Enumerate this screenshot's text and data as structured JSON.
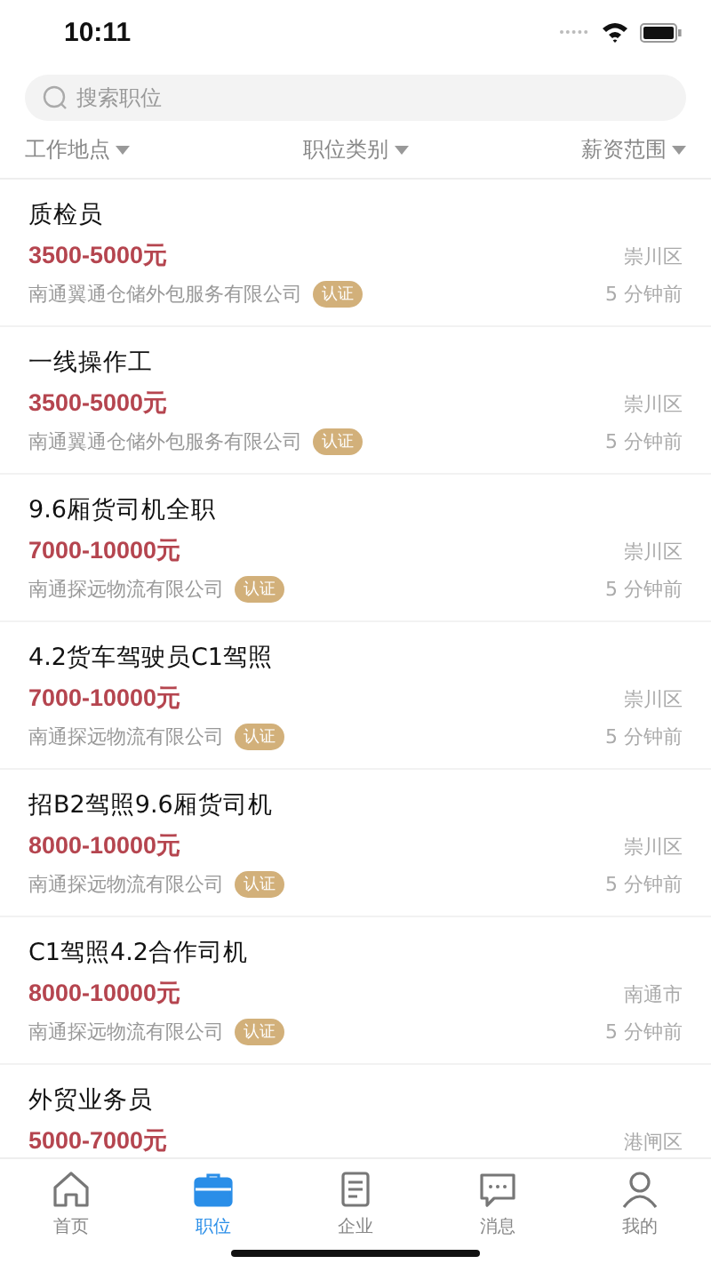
{
  "status_bar": {
    "time": "10:11"
  },
  "search": {
    "placeholder": "搜索职位"
  },
  "filters": [
    {
      "label": "工作地点"
    },
    {
      "label": "职位类别"
    },
    {
      "label": "薪资范围"
    }
  ],
  "jobs": [
    {
      "title": "质检员",
      "salary": "3500-5000元",
      "location": "崇川区",
      "company": "南通翼通仓储外包服务有限公司",
      "badge": "认证",
      "time": "5 分钟前"
    },
    {
      "title": "一线操作工",
      "salary": "3500-5000元",
      "location": "崇川区",
      "company": "南通翼通仓储外包服务有限公司",
      "badge": "认证",
      "time": "5 分钟前"
    },
    {
      "title": "9.6厢货司机全职",
      "salary": "7000-10000元",
      "location": "崇川区",
      "company": "南通探远物流有限公司",
      "badge": "认证",
      "time": "5 分钟前"
    },
    {
      "title": "4.2货车驾驶员C1驾照",
      "salary": "7000-10000元",
      "location": "崇川区",
      "company": "南通探远物流有限公司",
      "badge": "认证",
      "time": "5 分钟前"
    },
    {
      "title": "招B2驾照9.6厢货司机",
      "salary": "8000-10000元",
      "location": "崇川区",
      "company": "南通探远物流有限公司",
      "badge": "认证",
      "time": "5 分钟前"
    },
    {
      "title": "C1驾照4.2合作司机",
      "salary": "8000-10000元",
      "location": "南通市",
      "company": "南通探远物流有限公司",
      "badge": "认证",
      "time": "5 分钟前"
    },
    {
      "title": "外贸业务员",
      "salary": "5000-7000元",
      "location": "港闸区"
    }
  ],
  "tab_bar": [
    {
      "label": "首页",
      "kind": "home",
      "selected": false
    },
    {
      "label": "职位",
      "kind": "briefcase",
      "selected": true
    },
    {
      "label": "企业",
      "kind": "document",
      "selected": false
    },
    {
      "label": "消息",
      "kind": "chat",
      "selected": false
    },
    {
      "label": "我的",
      "kind": "person",
      "selected": false
    }
  ]
}
